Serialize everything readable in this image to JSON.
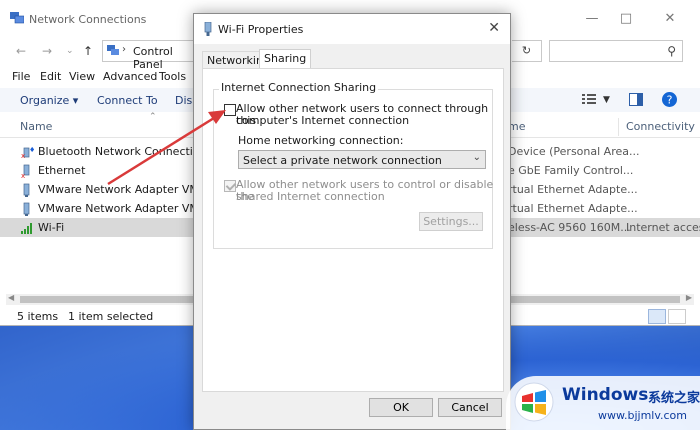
{
  "explorer": {
    "title": "Network Connections",
    "breadcrumb": "Control Panel",
    "menu": [
      "File",
      "Edit",
      "View",
      "Advanced",
      "Tools"
    ],
    "commands": {
      "organize": "Organize ▾",
      "connect_to": "Connect To",
      "disable": "Disa"
    },
    "columns": {
      "name": "Name",
      "device": "me",
      "connectivity": "Connectivity"
    },
    "rows": [
      {
        "name": "Bluetooth Network Connection",
        "device": "Device (Personal Area...",
        "connectivity": "",
        "icon": "bluetooth-network-icon"
      },
      {
        "name": "Ethernet",
        "device": "e GbE Family Control...",
        "connectivity": "",
        "icon": "ethernet-icon"
      },
      {
        "name": "VMware Network Adapter VMnet",
        "device": "rtual Ethernet Adapte...",
        "connectivity": "",
        "icon": "ethernet-icon"
      },
      {
        "name": "VMware Network Adapter VMnet",
        "device": "rtual Ethernet Adapte...",
        "connectivity": "",
        "icon": "ethernet-icon"
      },
      {
        "name": "Wi-Fi",
        "device": "eless-AC 9560 160M...",
        "connectivity": "Internet acces",
        "icon": "wifi-signal-icon"
      }
    ],
    "status": {
      "items": "5 items",
      "selected": "1 item selected"
    }
  },
  "dialog": {
    "title": "Wi-Fi Properties",
    "tabs": [
      {
        "label": "Networking",
        "active": false
      },
      {
        "label": "Sharing",
        "active": true
      }
    ],
    "group_label": "Internet Connection Sharing",
    "allow_connect": {
      "line1": "Allow other network users to connect through this",
      "line2": "computer's Internet connection",
      "checked": false
    },
    "home_label": "Home networking connection:",
    "home_select": "Select a private network connection",
    "allow_control": {
      "line1": "Allow other network users to control or disable the",
      "line2": "shared Internet connection",
      "checked": true,
      "disabled": true
    },
    "settings_button": "Settings...",
    "ok_button": "OK",
    "cancel_button": "Cancel"
  },
  "watermark": {
    "title": "Windows",
    "cn": "系统之家",
    "url": "www.bjjmlv.com"
  },
  "colors": {
    "accent": "#0b3a9c",
    "annotation": "#d93a3a",
    "selected_row": "#d9d9d9"
  }
}
